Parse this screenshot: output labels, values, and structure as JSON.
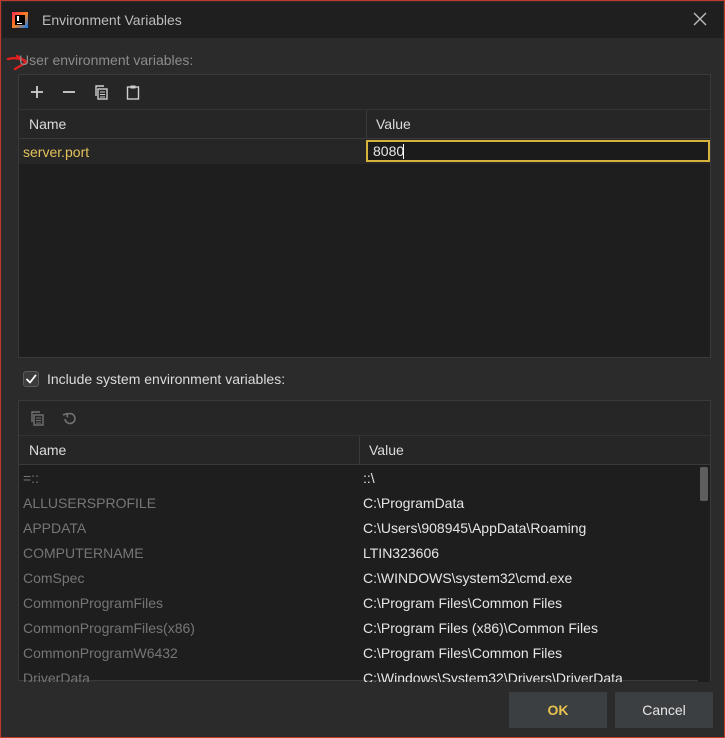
{
  "window": {
    "title": "Environment Variables"
  },
  "user_section": {
    "label": "User environment variables:",
    "columns": [
      "Name",
      "Value"
    ],
    "rows": [
      {
        "name": "server.port",
        "value": "8080"
      }
    ]
  },
  "system_section": {
    "checkbox_label": "Include system environment variables:",
    "checked": true,
    "columns": [
      "Name",
      "Value"
    ],
    "rows": [
      {
        "name": "=::",
        "value": "::\\"
      },
      {
        "name": "ALLUSERSPROFILE",
        "value": "C:\\ProgramData"
      },
      {
        "name": "APPDATA",
        "value": "C:\\Users\\908945\\AppData\\Roaming"
      },
      {
        "name": "COMPUTERNAME",
        "value": "LTIN323606"
      },
      {
        "name": "ComSpec",
        "value": "C:\\WINDOWS\\system32\\cmd.exe"
      },
      {
        "name": "CommonProgramFiles",
        "value": "C:\\Program Files\\Common Files"
      },
      {
        "name": "CommonProgramFiles(x86)",
        "value": "C:\\Program Files (x86)\\Common Files"
      },
      {
        "name": "CommonProgramW6432",
        "value": "C:\\Program Files\\Common Files"
      },
      {
        "name": "DriverData",
        "value": "C:\\Windows\\System32\\Drivers\\DriverData"
      }
    ]
  },
  "buttons": {
    "ok": "OK",
    "cancel": "Cancel"
  },
  "icons": {
    "user_toolbar": [
      "plus-icon",
      "minus-icon",
      "copy-icon",
      "paste-icon"
    ],
    "system_toolbar": [
      "copy-icon",
      "undo-icon"
    ]
  },
  "colors": {
    "accent_yellow": "#e5c15b",
    "edit_border": "#d6b33c",
    "window_border": "#c0392b",
    "annotation_red": "#e02020"
  }
}
